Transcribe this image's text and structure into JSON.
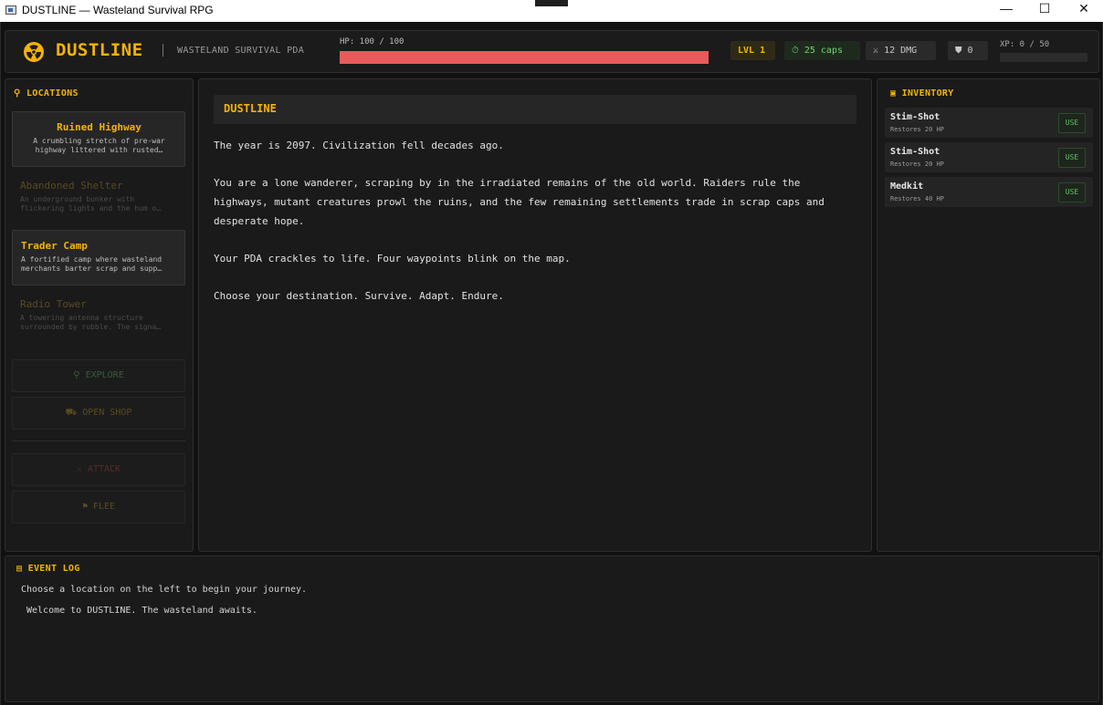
{
  "window": {
    "title": "DUSTLINE — Wasteland Survival RPG",
    "controls": {
      "minimize": "—",
      "maximize": "☐",
      "close": "✕"
    }
  },
  "header": {
    "brand": "DUSTLINE",
    "separator": "|",
    "subtitle": "WASTELAND SURVIVAL PDA",
    "hp_label": "HP: 100 / 100",
    "hp_fraction": 1.0,
    "level": "LVL 1",
    "caps": "25 caps",
    "damage": "12 DMG",
    "defense": "0",
    "xp_label": "XP: 0 / 50",
    "xp_fraction": 0.0,
    "icons": {
      "logo": "radiation-icon",
      "caps": "coin-icon",
      "damage": "crossed-swords-icon",
      "defense": "shield-icon"
    }
  },
  "locations": {
    "title": "LOCATIONS",
    "items": [
      {
        "name": "Ruined Highway",
        "desc": "A crumbling stretch of pre-war highway littered with rusted…",
        "state": "active"
      },
      {
        "name": "Abandoned Shelter",
        "desc": "An underground bunker with flickering lights and the hum o…",
        "state": "disabled"
      },
      {
        "name": "Trader Camp",
        "desc": "A fortified camp where wasteland merchants barter scrap and supp…",
        "state": "active"
      },
      {
        "name": "Radio Tower",
        "desc": "A towering antenna structure surrounded by rubble. The signa…",
        "state": "disabled"
      }
    ]
  },
  "actions": {
    "explore": "EXPLORE",
    "shop": "OPEN SHOP",
    "attack": "ATTACK",
    "flee": "FLEE"
  },
  "story": {
    "title": "DUSTLINE",
    "paragraphs": [
      "The year is 2097. Civilization fell decades ago.",
      "You are a lone wanderer, scraping by in the irradiated remains of the old world. Raiders rule the highways, mutant creatures prowl the ruins, and the few remaining settlements trade in scrap caps and desperate hope.",
      "Your PDA crackles to life. Four waypoints blink on the map.",
      "Choose your destination. Survive. Adapt. Endure."
    ]
  },
  "inventory": {
    "title": "INVENTORY",
    "use_label": "USE",
    "items": [
      {
        "name": "Stim-Shot",
        "desc": "Restores 20 HP"
      },
      {
        "name": "Stim-Shot",
        "desc": "Restores 20 HP"
      },
      {
        "name": "Medkit",
        "desc": "Restores 40 HP"
      }
    ]
  },
  "event_log": {
    "title": "EVENT LOG",
    "lines": [
      "Choose a location on the left to begin your journey.",
      "Welcome to DUSTLINE. The wasteland awaits."
    ]
  },
  "colors": {
    "accent": "#f4b400",
    "hp": "#ea5a5a",
    "caps": "#6fd46f",
    "background": "#111111",
    "panel": "#1a1a1a"
  }
}
